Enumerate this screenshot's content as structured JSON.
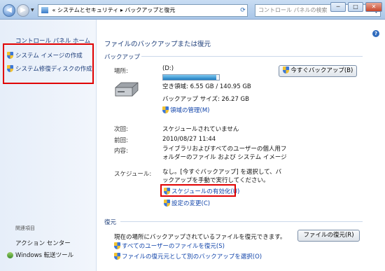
{
  "window": {
    "minimize": "─",
    "maximize": "□",
    "close": "✕"
  },
  "address": {
    "chevron": "«",
    "path": "システムとセキュリティ ▸ バックアップと復元",
    "search_placeholder": "コントロール パネルの検索"
  },
  "sidebar": {
    "home": "コントロール パネル ホーム",
    "tasks": [
      {
        "label": "システム イメージの作成"
      },
      {
        "label": "システム修復ディスクの作成"
      }
    ],
    "related_heading": "関連項目",
    "related": [
      {
        "label": "アクション センター"
      },
      {
        "label": "Windows 転送ツール"
      }
    ]
  },
  "main": {
    "title": "ファイルのバックアップまたは復元",
    "help": "?",
    "backup": {
      "heading": "バックアップ",
      "location_label": "場所:",
      "location_value": "(D:)",
      "free_space": "空き領域: 6.55 GB / 140.95 GB",
      "usage_fraction": 0.95,
      "backup_size": "バックアップ サイズ: 26.27 GB",
      "manage_space_link": "領域の管理(M)",
      "backup_now_button": "今すぐバックアップ(B)",
      "next_label": "次回:",
      "next_value": "スケジュールされていません",
      "last_label": "前回:",
      "last_value": "2010/08/27 11:44",
      "contents_label": "内容:",
      "contents_value": "ライブラリおよびすべてのユーザーの個人用フォルダーのファイル および システム イメージ",
      "schedule_label": "スケジュール:",
      "schedule_value": "なし。[今すぐバックアップ] を選択して、バックアップを手動で実行してください。",
      "enable_schedule_link": "スケジュールの有効化(U)",
      "change_settings_link": "設定の変更(C)"
    },
    "restore": {
      "heading": "復元",
      "text": "現在の場所にバックアップされているファイルを復元できます。",
      "restore_button": "ファイルの復元(R)",
      "all_users_link": "すべてのユーザーのファイルを復元(S)",
      "select_other_link": "ファイルの復元元として別のバックアップを選択(O)"
    }
  },
  "colors": {
    "highlight_box": "#e00000",
    "link": "#1144aa",
    "heading": "#1e3e7a"
  }
}
